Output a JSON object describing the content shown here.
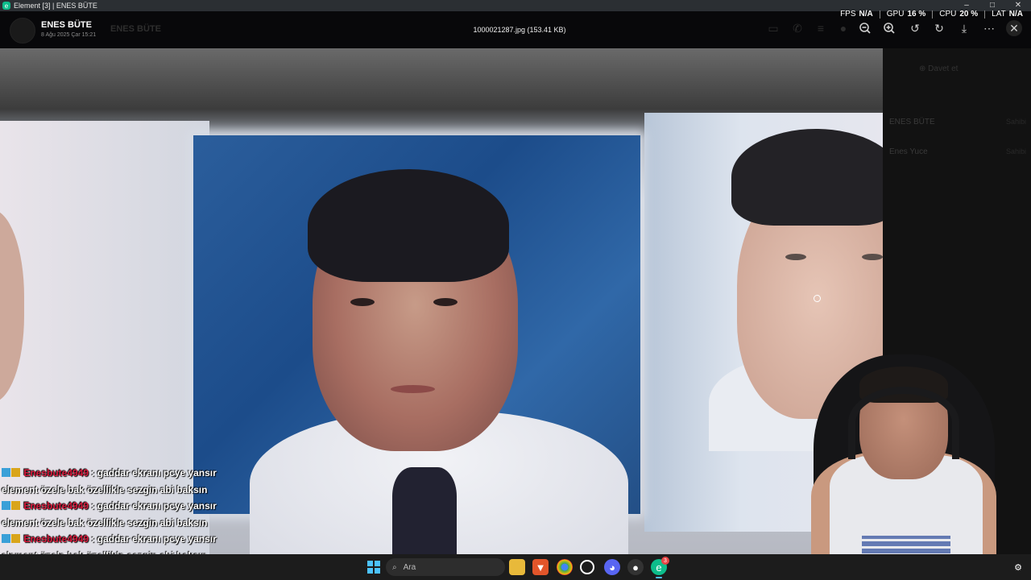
{
  "window": {
    "title": "Element [3] | ENES BÜTE",
    "controls": [
      "–",
      "□",
      "✕"
    ]
  },
  "stats": [
    {
      "label": "FPS",
      "value": "N/A"
    },
    {
      "label": "GPU",
      "value": "16 %"
    },
    {
      "label": "CPU",
      "value": "20 %"
    },
    {
      "label": "LAT",
      "value": "N/A"
    }
  ],
  "viewer": {
    "sender": "ENES BÜTE",
    "date": "8 Ağu 2025 Çar 15:21",
    "background_room": "ENES BÜTE",
    "file": "1000021287.jpg (153.41 KB)",
    "toolbar": {
      "zoom_out": "zoom-out-icon",
      "zoom_in": "zoom-in-icon",
      "rotate_left": "rotate-left-icon",
      "rotate_right": "rotate-right-icon",
      "download": "download-icon",
      "more": "more-options-icon",
      "close": "close-icon"
    }
  },
  "sidepanel": {
    "invite": "Davet et",
    "members": [
      {
        "name": "ENES BÜTE",
        "role": "Sahibi"
      },
      {
        "name": "Enes Yuce",
        "role": "Sahibi"
      }
    ]
  },
  "chat": [
    {
      "user": "Enesbute4949",
      "message": ": gaddar ekranı pcye yansır",
      "cont": "element özele bak özellikle sezgin abi baksın"
    },
    {
      "user": "Enesbute4949",
      "message": ": gaddar ekranı pcye yansır",
      "cont": "element özele bak özellikle sezgin abi baksın"
    },
    {
      "user": "Enesbute4949",
      "message": ": gaddar ekranı pcye yansır",
      "cont": "element özele bak özellikle sezgin abi baksın"
    }
  ],
  "taskbar": {
    "search_placeholder": "Ara",
    "element_badge": "3"
  }
}
